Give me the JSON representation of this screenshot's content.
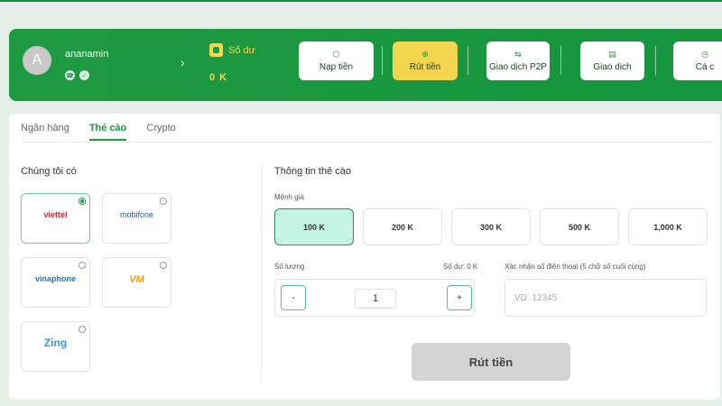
{
  "header": {
    "avatar_letter": "A",
    "username": "ananamin",
    "user_icons": [
      "phone-icon",
      "check-icon"
    ],
    "balance_label": "Số dư",
    "balance_value": "0 K",
    "actions": [
      {
        "label": "Nạp tiền",
        "icon": "deposit-icon"
      },
      {
        "label": "Rút tiền",
        "icon": "withdraw-icon",
        "active": true
      },
      {
        "label": "Giao dịch P2P",
        "icon": "p2p-icon"
      },
      {
        "label": "Giao dịch",
        "icon": "transaction-icon"
      },
      {
        "label": "Cá c",
        "icon": "clock-icon"
      }
    ]
  },
  "tabs": [
    {
      "label": "Ngân hàng"
    },
    {
      "label": "Thẻ cào",
      "active": true
    },
    {
      "label": "Crypto"
    }
  ],
  "left": {
    "title": "Chúng tôi có",
    "providers": [
      {
        "name": "viettel",
        "logo_text": "viettel",
        "color": "#d8262c",
        "selected": true
      },
      {
        "name": "mobifone",
        "logo_text": "mobifone",
        "color": "#2a5aa8"
      },
      {
        "name": "vinaphone",
        "logo_text": "vinaphone",
        "color": "#1976c8"
      },
      {
        "name": "vietnamobile",
        "logo_text": "VM",
        "color": "#f39c12"
      },
      {
        "name": "zing",
        "logo_text": "Zing",
        "color": "#2f9ed8"
      }
    ]
  },
  "right": {
    "title": "Thông tin thẻ cào",
    "denom_label": "Mệnh giá",
    "denominations": [
      {
        "label": "100 K",
        "selected": true
      },
      {
        "label": "200 K"
      },
      {
        "label": "300 K"
      },
      {
        "label": "500 K"
      },
      {
        "label": "1,000 K"
      }
    ],
    "qty_label": "Số lượng",
    "qty_balance": "Số dư: 0 K",
    "qty_minus": "-",
    "qty_plus": "+",
    "qty_value": "1",
    "phone_label": "Xác nhận số điện thoại (5 chữ số cuối cùng)",
    "phone_placeholder": "VD: 12345",
    "submit_label": "Rút tiền"
  },
  "colors": {
    "brand_green": "#1f9a43",
    "accent_yellow": "#f3d54d",
    "selected_denom": "#c5f3e4"
  }
}
